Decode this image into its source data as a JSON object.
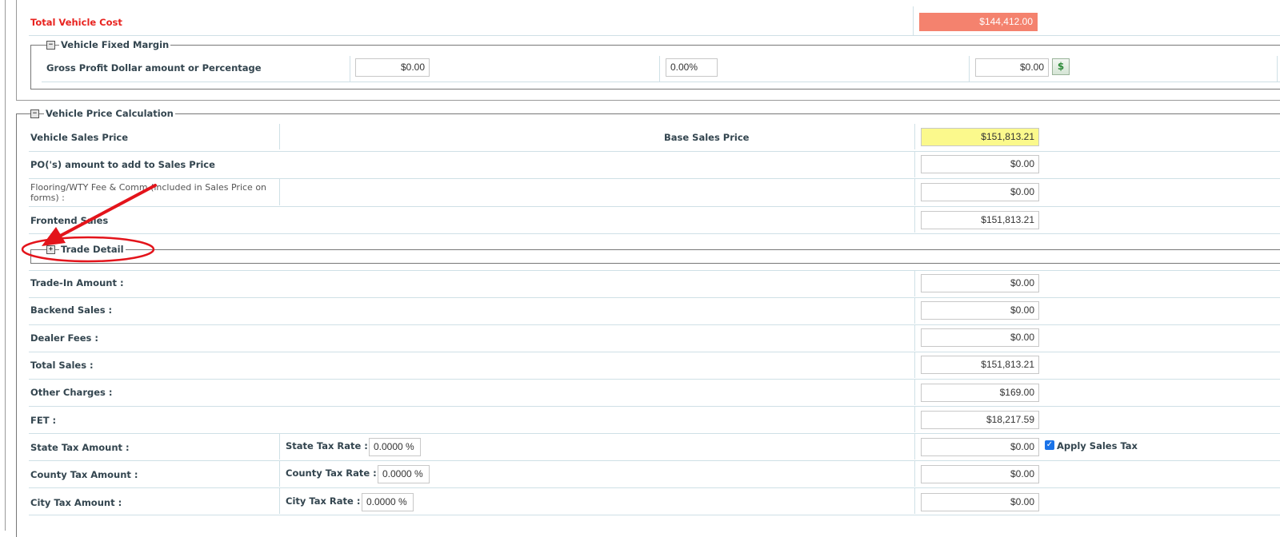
{
  "cost": {
    "total_label": "Total Vehicle Cost",
    "total_value": "$144,412.00"
  },
  "fixed_margin": {
    "legend": "Vehicle Fixed Margin",
    "toggle": "−",
    "label": "Gross Profit Dollar amount or Percentage",
    "dollar_value": "$0.00",
    "percent_value": "0.00%",
    "result_value": "$0.00",
    "calc_icon": "$"
  },
  "price_calc": {
    "legend": "Vehicle Price Calculation",
    "toggle": "−",
    "vehicle_sales_price_label": "Vehicle Sales Price",
    "base_sales_price_label": "Base Sales Price",
    "base_sales_price_value": "$151,813.21",
    "po_label": "PO('s) amount to add to Sales Price",
    "po_value": "$0.00",
    "flooring_label": "Flooring/WTY Fee & Comm (included in Sales Price on forms) :",
    "flooring_value": "$0.00",
    "frontend_label": "Frontend Sales",
    "frontend_value": "$151,813.21"
  },
  "trade_detail": {
    "legend": "Trade Detail",
    "toggle": "+"
  },
  "rows": {
    "trade_in_label": "Trade-In Amount :",
    "trade_in_value": "$0.00",
    "backend_label": "Backend Sales :",
    "backend_value": "$0.00",
    "dealer_fees_label": "Dealer Fees :",
    "dealer_fees_value": "$0.00",
    "total_sales_label": "Total Sales :",
    "total_sales_value": "$151,813.21",
    "other_charges_label": "Other Charges :",
    "other_charges_value": "$169.00",
    "fet_label": "FET :",
    "fet_value": "$18,217.59"
  },
  "tax": {
    "state_amount_label": "State Tax Amount :",
    "state_rate_label": "State Tax Rate :",
    "state_rate_value": "0.0000 %",
    "state_amount_value": "$0.00",
    "apply_sales_tax_label": "Apply Sales Tax",
    "apply_sales_tax_checked": true,
    "county_amount_label": "County Tax Amount :",
    "county_rate_label": "County Tax Rate :",
    "county_rate_value": "0.0000 %",
    "county_amount_value": "$0.00",
    "city_amount_label": "City Tax Amount :",
    "city_rate_label": "City Tax Rate :",
    "city_rate_value": "0.0000 %",
    "city_amount_value": "$0.00"
  },
  "colors": {
    "total_cost_text": "#e8231f",
    "total_cost_box": "#f4826e",
    "base_price_box": "#fbf98c",
    "annotation": "#e3141b"
  }
}
